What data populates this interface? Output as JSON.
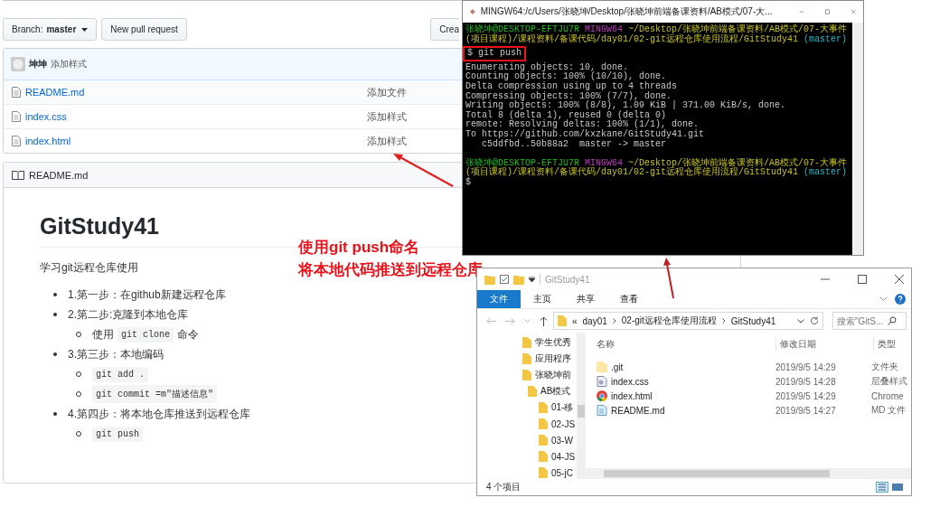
{
  "github": {
    "branch_button": "Branch: **master**",
    "pull_request_button": "New pull request",
    "create_button": "Crea",
    "commit": {
      "author": "坤坤",
      "message": "添加样式"
    },
    "files": [
      {
        "name": "README.md",
        "message": "添加文件"
      },
      {
        "name": "index.css",
        "message": "添加样式"
      },
      {
        "name": "index.html",
        "message": "添加样式"
      }
    ],
    "readme": {
      "header": "README.md",
      "title": "GitStudy41",
      "description": "学习git远程仓库使用",
      "steps": [
        {
          "parts": [
            {
              "kind": "text",
              "text": "1.第一步：在github新建远程仓库"
            }
          ]
        },
        {
          "parts": [
            {
              "kind": "text",
              "text": "2.第二步:克隆到本地仓库"
            }
          ],
          "children": [
            {
              "parts": [
                {
                  "kind": "text",
                  "text": "使用"
                },
                {
                  "kind": "code",
                  "text": "git clone"
                },
                {
                  "kind": "text",
                  "text": "命令"
                }
              ]
            }
          ]
        },
        {
          "parts": [
            {
              "kind": "text",
              "text": "3.第三步：本地编码"
            }
          ],
          "children": [
            {
              "parts": [
                {
                  "kind": "code",
                  "text": "git add ."
                }
              ]
            },
            {
              "parts": [
                {
                  "kind": "code",
                  "text": "git commit =m\"描述信息\""
                }
              ]
            }
          ]
        },
        {
          "parts": [
            {
              "kind": "text",
              "text": "4.第四步：将本地仓库推送到远程仓库"
            }
          ],
          "children": [
            {
              "parts": [
                {
                  "kind": "code",
                  "text": "git push"
                }
              ]
            }
          ]
        }
      ]
    }
  },
  "annotation": {
    "lines": [
      "使用git push命名",
      "将本地代码推送到远程仓库"
    ]
  },
  "terminal": {
    "title": "MINGW64:/c/Users/张晓坤/Desktop/张晓坤前端备课资料/AB模式/07-大...",
    "lines": [
      {
        "kind": "prompt",
        "user": "张晓坤@DESKTOP-EFTJU7R",
        "env": "MINGW64",
        "path": "~/Desktop/张晓坤前端备课资料/AB模式/07-大事件(项目课程)/课程资料/备课代码/day01/02-git远程仓库使用流程/GitStudy41",
        "branch": "(master)"
      },
      {
        "kind": "command",
        "text": "$ git push",
        "highlighted": true
      },
      {
        "kind": "output",
        "text": "Enumerating objects: 10, done."
      },
      {
        "kind": "output",
        "text": "Counting objects: 100% (10/10), done."
      },
      {
        "kind": "output",
        "text": "Delta compression using up to 4 threads"
      },
      {
        "kind": "output",
        "text": "Compressing objects: 100% (7/7), done."
      },
      {
        "kind": "output",
        "text": "Writing objects: 100% (8/8), 1.09 KiB | 371.00 KiB/s, done."
      },
      {
        "kind": "output",
        "text": "Total 8 (delta 1), reused 0 (delta 0)"
      },
      {
        "kind": "output",
        "text": "remote: Resolving deltas: 100% (1/1), done."
      },
      {
        "kind": "output",
        "text": "To https://github.com/kxzkane/GitStudy41.git"
      },
      {
        "kind": "output",
        "text": "   c5ddfbd..50b88a2  master -> master"
      },
      {
        "kind": "prompt",
        "user": "张晓坤@DESKTOP-EFTJU7R",
        "env": "MINGW64",
        "path": "~/Desktop/张晓坤前端备课资料/AB模式/07-大事件(项目课程)/课程资料/备课代码/day01/02-git远程仓库使用流程/GitStudy41",
        "branch": "(master)"
      },
      {
        "kind": "command",
        "text": "$",
        "highlighted": false
      }
    ]
  },
  "explorer": {
    "title": "GitStudy41",
    "ribbon_tabs": [
      {
        "label": "文件",
        "selected": true
      },
      {
        "label": "主页",
        "selected": false
      },
      {
        "label": "共享",
        "selected": false
      },
      {
        "label": "查看",
        "selected": false
      }
    ],
    "breadcrumb": [
      "«",
      "day01",
      "02-git远程仓库使用流程",
      "GitStudy41"
    ],
    "search": {
      "placeholder": "搜索\"GitS..."
    },
    "tree": [
      {
        "label": "学生优秀"
      },
      {
        "label": "应用程序"
      },
      {
        "label": "张晓坤前",
        "children": [
          {
            "label": "AB模式",
            "children": [
              {
                "label": "01-移"
              },
              {
                "label": "02-JS"
              },
              {
                "label": "03-W"
              },
              {
                "label": "04-JS"
              },
              {
                "label": "05-jC"
              }
            ]
          }
        ]
      }
    ],
    "columns": [
      "名称",
      "修改日期",
      "类型"
    ],
    "files": [
      {
        "kind": "folder",
        "name": ".git",
        "date": "2019/9/5 14:29",
        "type": "文件夹"
      },
      {
        "kind": "css",
        "name": "index.css",
        "date": "2019/9/5 14:28",
        "type": "层叠样式"
      },
      {
        "kind": "chrome",
        "name": "index.html",
        "date": "2019/9/5 14:29",
        "type": "Chrome"
      },
      {
        "kind": "md",
        "name": "README.md",
        "date": "2019/9/5 14:27",
        "type": "MD 文件"
      }
    ],
    "status": "4 个项目"
  }
}
